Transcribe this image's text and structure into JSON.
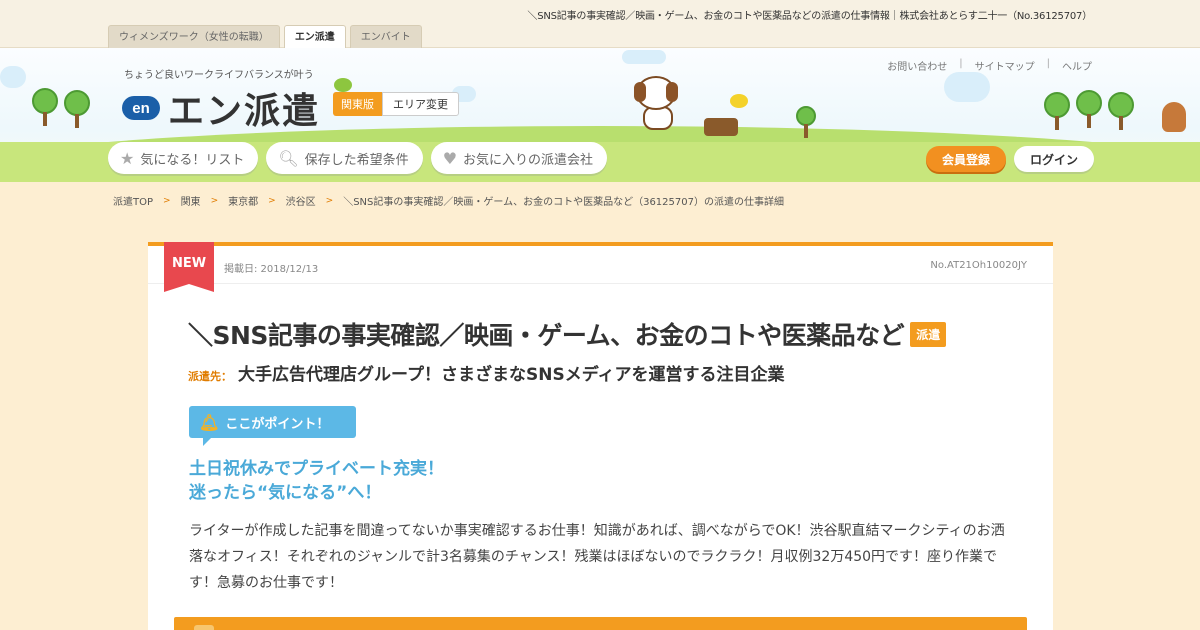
{
  "top": {
    "page_description": "＼SNS記事の事実確認／映画・ゲーム、お金のコトや医薬品などの派遣の仕事情報｜株式会社あとらす二十一（No.36125707）",
    "tabs": [
      {
        "label": "ウィメンズワーク（女性の転職）"
      },
      {
        "label": "エン派遣"
      },
      {
        "label": "エンバイト"
      }
    ]
  },
  "header": {
    "tagline": "ちょうど良いワークライフバランスが叶う",
    "logo_mark": "en",
    "logo_text": "エン派遣",
    "region_current": "関東版",
    "region_change": "エリア変更",
    "util_links": [
      "お問い合わせ",
      "サイトマップ",
      "ヘルプ"
    ],
    "nav": [
      {
        "label": "気になる！リスト",
        "icon": "star-icon"
      },
      {
        "label": "保存した希望条件",
        "icon": "search-icon"
      },
      {
        "label": "お気に入りの派遣会社",
        "icon": "heart-icon"
      }
    ],
    "register_label": "会員登録",
    "login_label": "ログイン"
  },
  "breadcrumb": [
    "派遣TOP",
    "関東",
    "東京都",
    "渋谷区",
    "＼SNS記事の事実確認／映画・ゲーム、お金のコトや医薬品など（36125707）の派遣の仕事詳細"
  ],
  "job": {
    "new_label": "NEW",
    "posted": "掲載日: 2018/12/13",
    "job_no": "No.AT21Oh10020JY",
    "title": "＼SNS記事の事実確認／映画・ゲーム、お金のコトや医薬品など",
    "type_badge": "派遣",
    "dest_label": "派遣先：",
    "dest_name": "大手広告代理店グループ！さまざまなSNSメディアを運営する注目企業",
    "point_label": "ここがポイント！",
    "catch_line1": "土日祝休みでプライベート充実！",
    "catch_line2": "迷ったら“気になる”へ！",
    "description": "ライターが作成した記事を間違ってないか事実確認するお仕事！知識があれば、調べながらでOK！渋谷駅直結マークシティのお洒落なオフィス！それぞれのジャンルで計3名募集のチャンス！残業はほぼないのでラクラク！月収例32万450円です！座り作業です！急募のお仕事です！"
  },
  "colors": {
    "accent": "#f39c1f",
    "new_red": "#e8484e",
    "point_blue": "#5cb8e6",
    "background": "#fdeed2"
  }
}
